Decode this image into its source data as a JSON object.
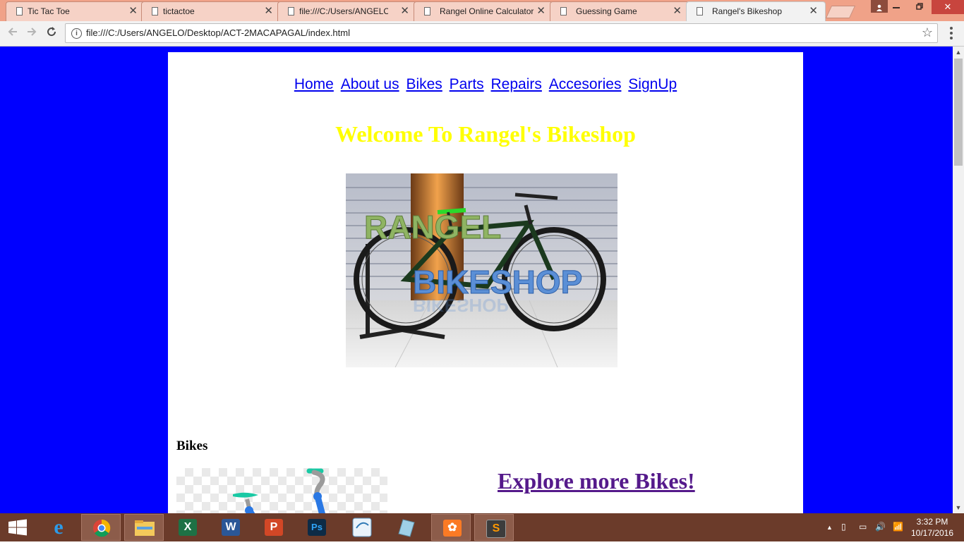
{
  "tabs": [
    {
      "title": "Tic Tac Toe"
    },
    {
      "title": "tictactoe"
    },
    {
      "title": "file:///C:/Users/ANGELO/"
    },
    {
      "title": "Rangel Online Calculator"
    },
    {
      "title": "Guessing Game"
    },
    {
      "title": "Rangel's Bikeshop"
    }
  ],
  "close_glyph": "✕",
  "address_bar": {
    "url": "file:///C:/Users/ANGELO/Desktop/ACT-2MACAPAGAL/index.html",
    "info_glyph": "i"
  },
  "page": {
    "nav": [
      "Home",
      "About us",
      "Bikes",
      "Parts",
      "Repairs",
      "Accesories",
      "SignUp "
    ],
    "welcome": "Welcome To Rangel's Bikeshop",
    "hero_logo": {
      "line1": "RANGEL",
      "line2": "BIKESHOP"
    },
    "bikes_heading": "Bikes",
    "explore_link": "Explore more Bikes!"
  },
  "taskbar": {
    "apps": [
      "internet-explorer",
      "chrome",
      "file-explorer",
      "excel",
      "word",
      "powerpoint",
      "photoshop",
      "mysql-installer",
      "notes",
      "xampp",
      "sublime-text"
    ],
    "app_glyphs": {
      "excel": "X",
      "word": "W",
      "powerpoint": "P",
      "photoshop": "Ps",
      "xampp": "✿",
      "sublime-text": "S",
      "internet-explorer": "e"
    },
    "time": "3:32 PM",
    "date": "10/17/2016"
  },
  "colors": {
    "page_bg": "#0000ff",
    "welcome_text": "#ffff00",
    "link": "#0000ee",
    "visited_link": "#551a8b",
    "taskbar": "#6b3b2a",
    "tabstrip": "#f0a288"
  }
}
